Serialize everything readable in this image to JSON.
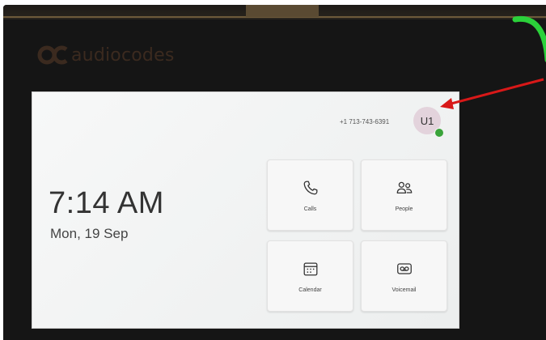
{
  "brand": {
    "logo_text": "audiocodes",
    "icon": "audiocodes-logo-icon"
  },
  "header": {
    "phone_number": "+1 713-743-6391",
    "avatar_initials": "U1",
    "presence_status_color": "#3aa33a"
  },
  "home": {
    "time": "7:14 AM",
    "date": "Mon, 19 Sep"
  },
  "tiles": [
    {
      "label": "Calls",
      "icon": "phone-icon"
    },
    {
      "label": "People",
      "icon": "people-icon"
    },
    {
      "label": "Calendar",
      "icon": "calendar-icon"
    },
    {
      "label": "Voicemail",
      "icon": "voicemail-icon"
    }
  ],
  "colors": {
    "led": "#2bd13a",
    "annotation_arrow": "#d81818",
    "screen_bg": "#f2f3f3"
  }
}
